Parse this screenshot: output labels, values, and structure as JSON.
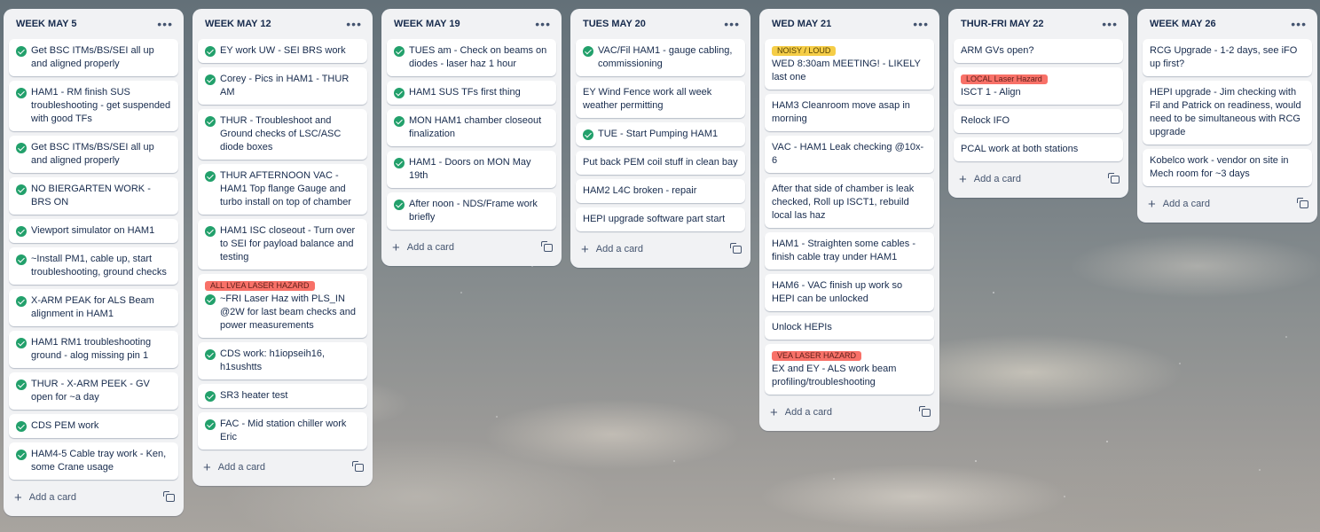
{
  "colors": {
    "check": "#22a06b",
    "label_yellow": "#f5cd47",
    "label_red": "#f87168",
    "list_bg": "#f1f2f4"
  },
  "icons": {
    "menu": "more-horizontal-icon",
    "check": "check-circle-icon",
    "add": "plus-icon",
    "template": "card-template-icon"
  },
  "lists": [
    {
      "title": "WEEK MAY 5",
      "cards": [
        {
          "text": "Get BSC ITMs/BS/SEI all up and aligned properly",
          "done": true
        },
        {
          "text": "HAM1 - RM finish SUS troubleshooting - get suspended with good TFs",
          "done": true
        },
        {
          "text": "Get BSC ITMs/BS/SEI all up and aligned properly",
          "done": true
        },
        {
          "text": "NO BIERGARTEN WORK - BRS ON",
          "done": true
        },
        {
          "text": "Viewport simulator on HAM1",
          "done": true
        },
        {
          "text": "~Install PM1, cable up, start troubleshooting, ground checks",
          "done": true
        },
        {
          "text": "X-ARM PEAK for ALS Beam alignment in HAM1",
          "done": true
        },
        {
          "text": "HAM1 RM1 troubleshooting ground - alog missing pin 1",
          "done": true
        },
        {
          "text": "THUR - X-ARM PEEK - GV open for ~a day",
          "done": true
        },
        {
          "text": "CDS PEM work",
          "done": true
        },
        {
          "text": "HAM4-5 Cable tray work - Ken, some Crane usage",
          "done": true
        }
      ],
      "add_label": "Add a card"
    },
    {
      "title": "WEEK MAY 12",
      "cards": [
        {
          "text": "EY work UW - SEI BRS work",
          "done": true
        },
        {
          "text": "Corey - Pics in HAM1 - THUR AM",
          "done": true
        },
        {
          "text": "THUR - Troubleshoot and Ground checks of LSC/ASC diode boxes",
          "done": true
        },
        {
          "text": "THUR AFTERNOON VAC - HAM1 Top flange Gauge and turbo install on top of chamber",
          "done": true
        },
        {
          "text": "HAM1 ISC closeout - Turn over to SEI for payload balance and testing",
          "done": true
        },
        {
          "label": "ALL LVEA LASER HAZARD",
          "label_color": "red",
          "text": "~FRI Laser Haz with PLS_IN @2W for last beam checks and power measurements",
          "done": true
        },
        {
          "text": "CDS work: h1iopseih16, h1sushtts",
          "done": true
        },
        {
          "text": "SR3 heater test",
          "done": true
        },
        {
          "text": "FAC - Mid station chiller work Eric",
          "done": true
        }
      ],
      "add_label": "Add a card"
    },
    {
      "title": "WEEK MAY 19",
      "cards": [
        {
          "text": "TUES am - Check on beams on diodes - laser haz 1 hour",
          "done": true
        },
        {
          "text": "HAM1 SUS TFs first thing",
          "done": true
        },
        {
          "text": "MON HAM1 chamber closeout finalization",
          "done": true
        },
        {
          "text": "HAM1 - Doors on MON May 19th",
          "done": true
        },
        {
          "text": "After noon - NDS/Frame work briefly",
          "done": true
        }
      ],
      "add_label": "Add a card"
    },
    {
      "title": "TUES MAY 20",
      "cards": [
        {
          "text": "VAC/Fil HAM1 - gauge cabling, commissioning",
          "done": true
        },
        {
          "text": "EY Wind Fence work all week weather permitting",
          "done": false
        },
        {
          "text": "TUE - Start Pumping HAM1",
          "done": true
        },
        {
          "text": "Put back PEM coil stuff in clean bay",
          "done": false
        },
        {
          "text": "HAM2 L4C broken - repair",
          "done": false
        },
        {
          "text": "HEPI upgrade software part start",
          "done": false
        }
      ],
      "add_label": "Add a card"
    },
    {
      "title": "WED MAY 21",
      "cards": [
        {
          "label": "NOISY / LOUD",
          "label_color": "yellow",
          "text": "WED 8:30am MEETING! - LIKELY last one",
          "done": false
        },
        {
          "text": "HAM3 Cleanroom move asap in morning",
          "done": false
        },
        {
          "text": "VAC - HAM1 Leak checking @10x-6",
          "done": false
        },
        {
          "text": "After that side of chamber is leak checked, Roll up ISCT1, rebuild local las haz",
          "done": false
        },
        {
          "text": "HAM1 - Straighten some cables - finish cable tray under HAM1",
          "done": false
        },
        {
          "text": "HAM6 - VAC finish up work so HEPI can be unlocked",
          "done": false
        },
        {
          "text": "Unlock HEPIs",
          "done": false
        },
        {
          "label": "VEA LASER HAZARD",
          "label_color": "red",
          "text": "EX and EY - ALS work beam profiling/troubleshooting",
          "done": false
        }
      ],
      "add_label": "Add a card"
    },
    {
      "title": "THUR-FRI MAY 22",
      "cards": [
        {
          "text": "ARM GVs open?",
          "done": false
        },
        {
          "label": "LOCAL Laser Hazard",
          "label_color": "red",
          "text": "ISCT 1 - Align",
          "done": false
        },
        {
          "text": "Relock IFO",
          "done": false
        },
        {
          "text": "PCAL work at both stations",
          "done": false
        }
      ],
      "add_label": "Add a card"
    },
    {
      "title": "WEEK MAY 26",
      "cards": [
        {
          "text": "RCG Upgrade - 1-2 days, see iFO up first?",
          "done": false
        },
        {
          "text": "HEPI upgrade - Jim checking with Fil and Patrick on readiness, would need to be simultaneous with RCG upgrade",
          "done": false
        },
        {
          "text": "Kobelco work - vendor on site in Mech room for ~3 days",
          "done": false
        }
      ],
      "add_label": "Add a card"
    }
  ]
}
